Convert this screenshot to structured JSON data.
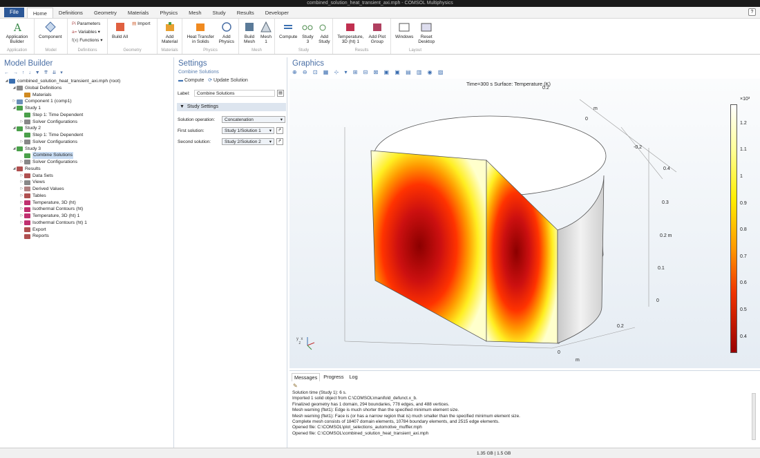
{
  "window_title": "combined_solution_heat_transient_axi.mph - COMSOL Multiphysics",
  "menu": {
    "file": "File",
    "tabs": [
      "Home",
      "Definitions",
      "Geometry",
      "Materials",
      "Physics",
      "Mesh",
      "Study",
      "Results",
      "Developer"
    ],
    "active": "Home",
    "help": "?"
  },
  "ribbon": {
    "application_builder": "Application Builder",
    "component": "Component",
    "parameters": "Parameters",
    "variables": "Variables",
    "functions": "Functions",
    "build_all": "Build All",
    "import": "Import",
    "add_material": "Add Material",
    "heat_transfer": "Heat Transfer in Solids",
    "add_physics": "Add Physics",
    "build_mesh": "Build Mesh",
    "mesh1": "Mesh 1",
    "compute": "Compute",
    "study3": "Study 3",
    "add_study": "Add Study",
    "temperature3d": "Temperature, 3D (ht) 1",
    "add_plot_group": "Add Plot Group",
    "windows": "Windows",
    "reset_desktop": "Reset Desktop",
    "groups": [
      "Application",
      "Model",
      "Definitions",
      "Geometry",
      "Materials",
      "Physics",
      "Mesh",
      "Study",
      "Results",
      "Layout"
    ]
  },
  "model_builder": {
    "title": "Model Builder",
    "tree": [
      {
        "label": "combined_solution_heat_transient_axi.mph (root)",
        "depth": 0,
        "arrow": "◢",
        "color": "#3a6fb0"
      },
      {
        "label": "Global Definitions",
        "depth": 1,
        "arrow": "◢",
        "color": "#8a8a8a"
      },
      {
        "label": "Materials",
        "depth": 2,
        "arrow": "",
        "color": "#d08a20"
      },
      {
        "label": "Component 1 (comp1)",
        "depth": 1,
        "arrow": "▷",
        "color": "#6a8fb8"
      },
      {
        "label": "Study 1",
        "depth": 1,
        "arrow": "◢",
        "color": "#4aa04a"
      },
      {
        "label": "Step 1: Time Dependent",
        "depth": 2,
        "arrow": "",
        "color": "#4aa04a"
      },
      {
        "label": "Solver Configurations",
        "depth": 2,
        "arrow": "▷",
        "color": "#888888"
      },
      {
        "label": "Study 2",
        "depth": 1,
        "arrow": "◢",
        "color": "#4aa04a"
      },
      {
        "label": "Step 1: Time Dependent",
        "depth": 2,
        "arrow": "",
        "color": "#4aa04a"
      },
      {
        "label": "Solver Configurations",
        "depth": 2,
        "arrow": "▷",
        "color": "#888888"
      },
      {
        "label": "Study 3",
        "depth": 1,
        "arrow": "◢",
        "color": "#4aa04a"
      },
      {
        "label": "Combine Solutions",
        "depth": 2,
        "arrow": "",
        "color": "#4aa04a",
        "selected": true
      },
      {
        "label": "Solver Configurations",
        "depth": 2,
        "arrow": "▷",
        "color": "#888888"
      },
      {
        "label": "Results",
        "depth": 1,
        "arrow": "◢",
        "color": "#b05050"
      },
      {
        "label": "Data Sets",
        "depth": 2,
        "arrow": "▷",
        "color": "#b05050"
      },
      {
        "label": "Views",
        "depth": 2,
        "arrow": "▷",
        "color": "#888888"
      },
      {
        "label": "Derived Values",
        "depth": 2,
        "arrow": "▷",
        "color": "#b08080"
      },
      {
        "label": "Tables",
        "depth": 2,
        "arrow": "▷",
        "color": "#b05050"
      },
      {
        "label": "Temperature, 3D (ht)",
        "depth": 2,
        "arrow": "▷",
        "color": "#c03070"
      },
      {
        "label": "Isothermal Contours (ht)",
        "depth": 2,
        "arrow": "▷",
        "color": "#c03070"
      },
      {
        "label": "Temperature, 3D (ht) 1",
        "depth": 2,
        "arrow": "▷",
        "color": "#c03070"
      },
      {
        "label": "Isothermal Contours (ht) 1",
        "depth": 2,
        "arrow": "▷",
        "color": "#c03070"
      },
      {
        "label": "Export",
        "depth": 2,
        "arrow": "",
        "color": "#b05050"
      },
      {
        "label": "Reports",
        "depth": 2,
        "arrow": "",
        "color": "#b05050"
      }
    ]
  },
  "settings": {
    "title": "Settings",
    "subtitle": "Combine Solutions",
    "compute": "Compute",
    "update": "Update Solution",
    "label_caption": "Label:",
    "label_value": "Combine Solutions",
    "section": "Study Settings",
    "solution_operation_caption": "Solution operation:",
    "solution_operation": "Concatenation",
    "first_caption": "First solution:",
    "first": "Study 1/Solution 1",
    "second_caption": "Second solution:",
    "second": "Study 2/Solution 2"
  },
  "graphics": {
    "title": "Graphics",
    "caption": "Time=300 s   Surface: Temperature (K)",
    "axis_labels": {
      "y_top": "m",
      "y_top_0": "0",
      "y_top_n02": "-0.2",
      "y_top_02": "0.2",
      "z04": "0.4",
      "z03": "0.3",
      "z02": "0.2  m",
      "z01": "0.1",
      "z0": "0",
      "x02": "0.2",
      "x0": "0",
      "xm": "m"
    },
    "colorbar": {
      "exp": "×10³",
      "ticks": [
        "1.2",
        "1.1",
        "1",
        "0.9",
        "0.8",
        "0.7",
        "0.6",
        "0.5",
        "0.4"
      ]
    }
  },
  "messages": {
    "tabs": [
      "Messages",
      "Progress",
      "Log"
    ],
    "lines": [
      "Solution time (Study 1): 6 s.",
      "Imported 1 solid object from C:\\COMSOL\\manifold_defunct.x_b.",
      "Finalized geometry has 1 domain, 294 boundaries, 778 edges, and 488 vertices.",
      "Mesh warning (ftet1): Edge is much shorter than the specified minimum element size.",
      "Mesh warning (ftet1): Face is (or has a narrow region that is) much smaller than the specified minimum element size.",
      "Complete mesh consists of 18407 domain elements, 10784 boundary elements, and 2515 edge elements.",
      "Opened file: C:\\COMSOL\\plot_selections_automotive_muffler.mph",
      "Opened file: C:\\COMSOL\\combined_solution_heat_transient_axi.mph"
    ]
  },
  "status": {
    "memory": "1.35 GB | 1.5 GB"
  }
}
